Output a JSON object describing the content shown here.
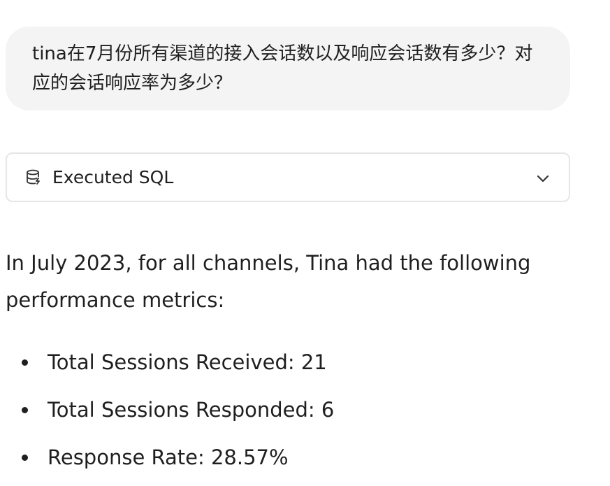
{
  "user_message": {
    "text": "tina在7月份所有渠道的接入会话数以及响应会话数有多少？对应的会话响应率为多少？"
  },
  "sql_panel": {
    "icon": "database-icon",
    "label": "Executed SQL",
    "toggle_icon": "chevron-down-icon"
  },
  "answer": {
    "intro": "In July 2023, for all channels, Tina had the following performance metrics:",
    "items": [
      {
        "text": "Total Sessions Received: 21"
      },
      {
        "text": "Total Sessions Responded: 6"
      },
      {
        "text": "Response Rate: 28.57%"
      }
    ]
  }
}
